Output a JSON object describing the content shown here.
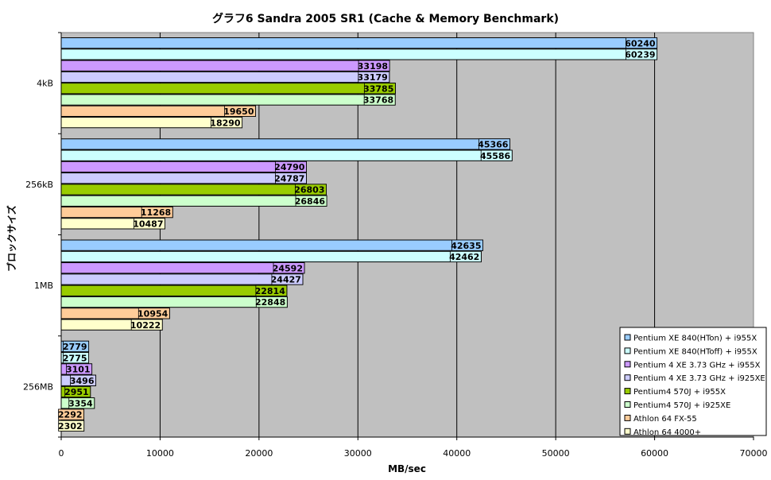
{
  "chart_data": {
    "type": "bar",
    "orientation": "horizontal",
    "title": "グラフ6  Sandra 2005 SR1 (Cache & Memory Benchmark)",
    "xlabel": "MB/sec",
    "ylabel": "ブロックサイズ",
    "xlim": [
      0,
      70000
    ],
    "xticks": [
      "0",
      "10000",
      "20000",
      "30000",
      "40000",
      "50000",
      "60000",
      "70000"
    ],
    "grid": true,
    "legend_position": "bottom-right",
    "categories": [
      "4kB",
      "256kB",
      "1MB",
      "256MB"
    ],
    "series": [
      {
        "name": "Pentium XE 840(HTon) + i955X",
        "color": "#99ccff",
        "values": [
          60240,
          45366,
          42635,
          2779
        ]
      },
      {
        "name": "Pentium XE 840(HToff) + i955X",
        "color": "#ccffff",
        "values": [
          60239,
          45586,
          42462,
          2775
        ]
      },
      {
        "name": "Pentium 4 XE 3.73 GHz + i955X",
        "color": "#cc99ff",
        "values": [
          33198,
          24790,
          24592,
          3101
        ]
      },
      {
        "name": "Pentium 4 XE 3.73 GHz + i925XE",
        "color": "#ccccff",
        "values": [
          33179,
          24787,
          24427,
          3496
        ]
      },
      {
        "name": "Pentium4 570J + i955X",
        "color": "#99cc00",
        "values": [
          33785,
          26803,
          22814,
          2951
        ]
      },
      {
        "name": "Pentium4 570J + i925XE",
        "color": "#ccffcc",
        "values": [
          33768,
          26846,
          22848,
          3354
        ]
      },
      {
        "name": "Athlon 64 FX-55",
        "color": "#ffcc99",
        "values": [
          19650,
          11268,
          10954,
          2292
        ]
      },
      {
        "name": "Athlon 64 4000+",
        "color": "#ffffcc",
        "values": [
          18290,
          10487,
          10222,
          2302
        ]
      }
    ]
  }
}
